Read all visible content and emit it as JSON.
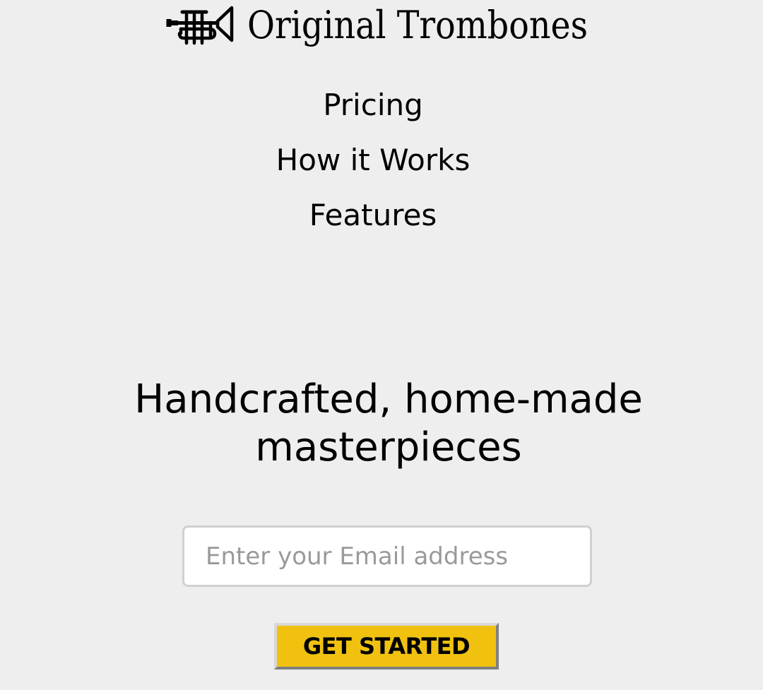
{
  "header": {
    "brand_name": "Original Trombones",
    "logo_icon": "trumpet-icon"
  },
  "nav": {
    "items": [
      {
        "label": "Pricing"
      },
      {
        "label": "How it Works"
      },
      {
        "label": "Features"
      }
    ]
  },
  "hero": {
    "title": "Handcrafted, home-made masterpieces"
  },
  "form": {
    "email_placeholder": "Enter your Email address",
    "email_value": "",
    "submit_label": "GET STARTED"
  },
  "colors": {
    "background": "#eeeeee",
    "button": "#f0c20f",
    "text": "#000000"
  }
}
